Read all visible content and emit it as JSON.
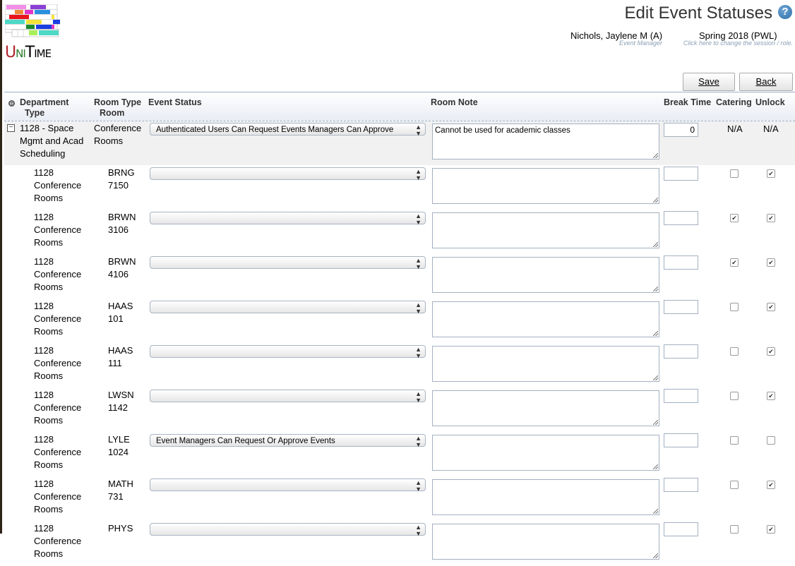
{
  "header": {
    "logo_text": "UniTime",
    "title": "Edit Event Statuses",
    "user_name": "Nichols, Jaylene M (A)",
    "user_role": "Event Manager",
    "session": "Spring 2018 (PWL)",
    "session_hint": "Click here to change the session / role."
  },
  "buttons": {
    "save": "Save",
    "back": "Back"
  },
  "columns": {
    "department": "Department",
    "type": "Type",
    "room_type": "Room Type",
    "room": "Room",
    "event_status": "Event Status",
    "room_note": "Room Note",
    "break_time": "Break Time",
    "catering": "Catering",
    "unlock": "Unlock"
  },
  "department_row": {
    "department_line1": "1128 - Space",
    "department_line2": "Mgmt and Acad",
    "department_line3": "Scheduling",
    "room_type_line1": "Conference",
    "room_type_line2": "Rooms",
    "event_status": "Authenticated Users Can Request Events Managers Can Approve",
    "room_note": "Cannot be used for academic classes",
    "break_time": "0",
    "catering": "N/A",
    "unlock": "N/A"
  },
  "rooms": [
    {
      "dept": "1128",
      "type1": "Conference",
      "type2": "Rooms",
      "bldg": "BRNG",
      "num": "7150",
      "status": "",
      "note": "",
      "break_time": "",
      "catering": false,
      "unlock": true
    },
    {
      "dept": "1128",
      "type1": "Conference",
      "type2": "Rooms",
      "bldg": "BRWN",
      "num": "3106",
      "status": "",
      "note": "",
      "break_time": "",
      "catering": true,
      "unlock": true
    },
    {
      "dept": "1128",
      "type1": "Conference",
      "type2": "Rooms",
      "bldg": "BRWN",
      "num": "4106",
      "status": "",
      "note": "",
      "break_time": "",
      "catering": true,
      "unlock": true
    },
    {
      "dept": "1128",
      "type1": "Conference",
      "type2": "Rooms",
      "bldg": "HAAS",
      "num": "101",
      "status": "",
      "note": "",
      "break_time": "",
      "catering": false,
      "unlock": true
    },
    {
      "dept": "1128",
      "type1": "Conference",
      "type2": "Rooms",
      "bldg": "HAAS",
      "num": "111",
      "status": "",
      "note": "",
      "break_time": "",
      "catering": false,
      "unlock": true
    },
    {
      "dept": "1128",
      "type1": "Conference",
      "type2": "Rooms",
      "bldg": "LWSN",
      "num": "1142",
      "status": "",
      "note": "",
      "break_time": "",
      "catering": false,
      "unlock": true
    },
    {
      "dept": "1128",
      "type1": "Conference",
      "type2": "Rooms",
      "bldg": "LYLE",
      "num": "1024",
      "status": "Event Managers Can Request Or Approve Events",
      "note": "",
      "break_time": "",
      "catering": false,
      "unlock": false
    },
    {
      "dept": "1128",
      "type1": "Conference",
      "type2": "Rooms",
      "bldg": "MATH",
      "num": "731",
      "status": "",
      "note": "",
      "break_time": "",
      "catering": false,
      "unlock": true
    },
    {
      "dept": "1128",
      "type1": "Conference",
      "type2": "Rooms",
      "bldg": "PHYS",
      "num": "",
      "status": "",
      "note": "",
      "break_time": "",
      "catering": false,
      "unlock": true
    }
  ]
}
